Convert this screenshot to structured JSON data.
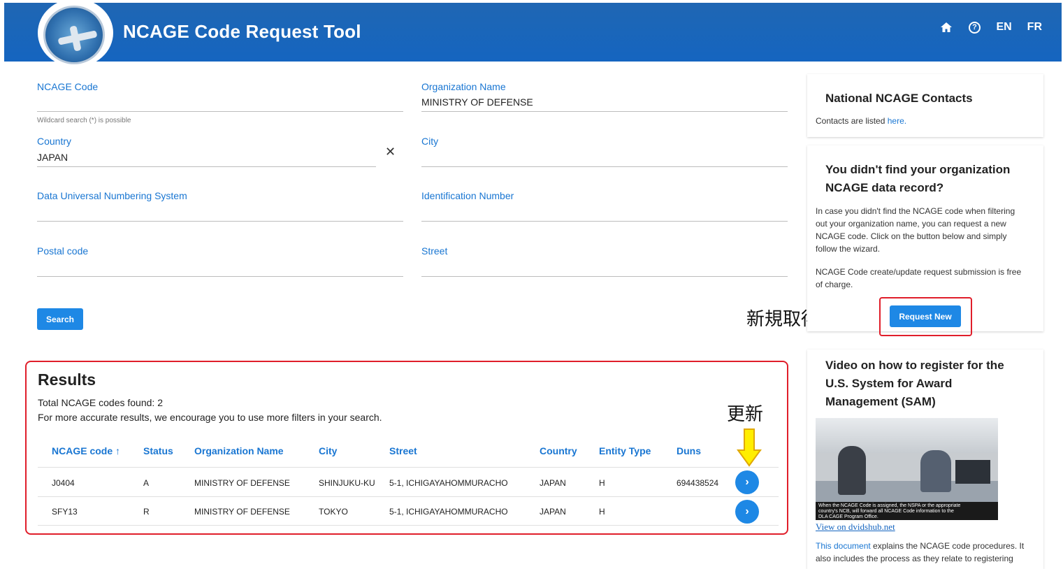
{
  "header": {
    "title": "NCAGE Code Request Tool",
    "home_icon": "home-icon",
    "help_icon": "help-icon",
    "lang_en": "EN",
    "lang_fr": "FR"
  },
  "form": {
    "ncage_code": {
      "label": "NCAGE Code",
      "value": "",
      "hint": "Wildcard search (*) is possible"
    },
    "organization_name": {
      "label": "Organization Name",
      "value": "MINISTRY OF DEFENSE"
    },
    "country": {
      "label": "Country",
      "value": "JAPAN",
      "clear": "✕"
    },
    "city": {
      "label": "City",
      "value": ""
    },
    "duns": {
      "label": "Data Universal Numbering System",
      "value": ""
    },
    "identification_number": {
      "label": "Identification Number",
      "value": ""
    },
    "postal_code": {
      "label": "Postal code",
      "value": ""
    },
    "street": {
      "label": "Street",
      "value": ""
    },
    "search_label": "Search"
  },
  "results": {
    "title": "Results",
    "count_text": "Total NCAGE codes found: 2",
    "tip": "For more accurate results, we encourage you to use more filters in your search.",
    "columns": [
      "NCAGE code ↑",
      "Status",
      "Organization Name",
      "City",
      "Street",
      "Country",
      "Entity Type",
      "Duns"
    ],
    "rows": [
      {
        "code": "J0404",
        "status": "A",
        "org": "MINISTRY OF DEFENSE",
        "city": "SHINJUKU-KU",
        "street": "5-1, ICHIGAYAHOMMURACHO",
        "country": "JAPAN",
        "entity": "H",
        "duns": "694438524"
      },
      {
        "code": "SFY13",
        "status": "R",
        "org": "MINISTRY OF DEFENSE",
        "city": "TOKYO",
        "street": "5-1, ICHIGAYAHOMMURACHO",
        "country": "JAPAN",
        "entity": "H",
        "duns": ""
      }
    ],
    "row_button": "›"
  },
  "annotations": {
    "new_text": "新規取得",
    "update_text": "更新",
    "accent": "#e01e2a",
    "arrow_fill": "#ffee00"
  },
  "sidebar": {
    "contacts": {
      "title": "National NCAGE Contacts",
      "text": "Contacts are listed ",
      "link": "here."
    },
    "not_found": {
      "title_line1": "You didn't find your organization",
      "title_line2": "NCAGE data record?",
      "p1_l1": "In case you didn't find the NCAGE code when filtering",
      "p1_l2": "out your organization name, you can request a new",
      "p1_l3": "NCAGE code. Click on the button below and simply",
      "p1_l4": "follow the wizard.",
      "p2_l1": "NCAGE Code create/update request submission is free",
      "p2_l2": "of charge.",
      "button": "Request New"
    },
    "video": {
      "title_line1": "Video on how to register for the",
      "title_line2": "U.S. System for Award",
      "title_line3": "Management (SAM)",
      "caption_l1": "When the NCAGE Code is assigned, the NSPA or the appropriate",
      "caption_l2": "country's NCB, will forward all NCAGE Code information to the",
      "caption_l3": "DLA CAGE Program Office.",
      "link": "View on dvidshub.net",
      "doc_link": "This document",
      "doc_l1": " explains the NCAGE code procedures. It",
      "doc_l2": "also includes the process as they relate to registering"
    }
  },
  "colors": {
    "primary": "#1976d2",
    "header_bg": "#1565c0",
    "button": "#1e88e5"
  }
}
